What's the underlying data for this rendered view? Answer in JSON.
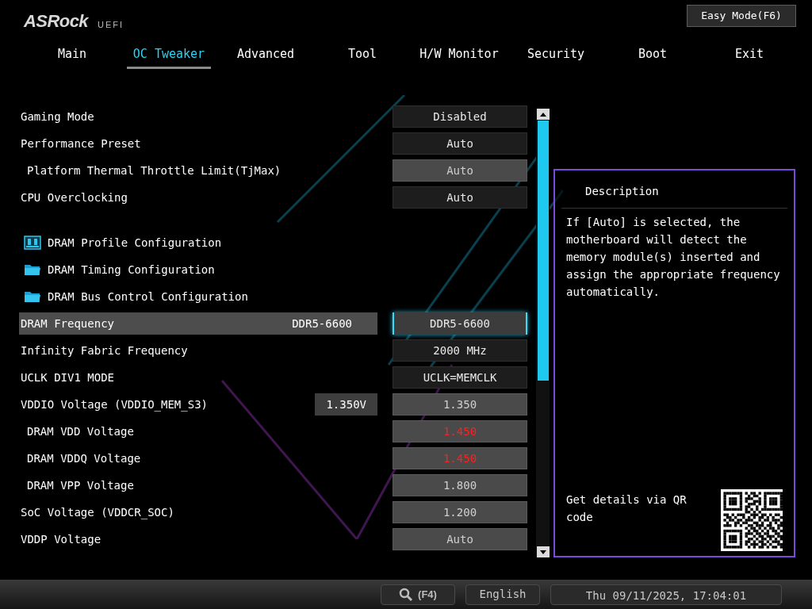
{
  "header": {
    "logo": "ASRock",
    "logo_suffix": "UEFI",
    "mode_button": "Easy Mode(F6)"
  },
  "tabs": [
    {
      "label": "Main",
      "selected": false
    },
    {
      "label": "OC Tweaker",
      "selected": true
    },
    {
      "label": "Advanced",
      "selected": false
    },
    {
      "label": "Tool",
      "selected": false
    },
    {
      "label": "H/W Monitor",
      "selected": false
    },
    {
      "label": "Security",
      "selected": false
    },
    {
      "label": "Boot",
      "selected": false
    },
    {
      "label": "Exit",
      "selected": false
    }
  ],
  "settings": [
    {
      "kind": "option",
      "label": "Gaming Mode",
      "value": "Disabled",
      "indented": false,
      "selected": false,
      "disabled": false,
      "warning": false
    },
    {
      "kind": "option",
      "label": "Performance Preset",
      "value": "Auto",
      "indented": false,
      "selected": false,
      "disabled": false,
      "warning": false
    },
    {
      "kind": "option",
      "label": "Platform Thermal Throttle Limit(TjMax)",
      "value": "Auto",
      "indented": true,
      "selected": false,
      "disabled": true,
      "warning": false
    },
    {
      "kind": "option",
      "label": "CPU Overclocking",
      "value": "Auto",
      "indented": false,
      "selected": false,
      "disabled": false,
      "warning": false
    },
    {
      "kind": "memory-menu",
      "label": "DRAM Profile Configuration"
    },
    {
      "kind": "folder-menu",
      "label": "DRAM Timing Configuration"
    },
    {
      "kind": "folder-menu",
      "label": "DRAM Bus Control Configuration"
    },
    {
      "kind": "option",
      "label": "DRAM Frequency",
      "current": "DDR5-6600",
      "value": "DDR5-6600",
      "indented": false,
      "selected": true,
      "disabled": false,
      "warning": false
    },
    {
      "kind": "option",
      "label": "Infinity Fabric Frequency",
      "value": "2000 MHz",
      "indented": false,
      "selected": false,
      "disabled": false,
      "warning": false
    },
    {
      "kind": "option",
      "label": "UCLK DIV1 MODE",
      "value": "UCLK=MEMCLK",
      "indented": false,
      "selected": false,
      "disabled": false,
      "warning": false
    },
    {
      "kind": "option",
      "label": "VDDIO Voltage (VDDIO_MEM_S3)",
      "reading": "1.350V",
      "value": "1.350",
      "indented": false,
      "selected": false,
      "disabled": true,
      "warning": false
    },
    {
      "kind": "option",
      "label": "DRAM VDD Voltage",
      "value": "1.450",
      "indented": true,
      "selected": false,
      "disabled": true,
      "warning": true
    },
    {
      "kind": "option",
      "label": "DRAM VDDQ Voltage",
      "value": "1.450",
      "indented": true,
      "selected": false,
      "disabled": true,
      "warning": true
    },
    {
      "kind": "option",
      "label": "DRAM VPP Voltage",
      "value": "1.800",
      "indented": true,
      "selected": false,
      "disabled": true,
      "warning": false
    },
    {
      "kind": "option",
      "label": "SoC Voltage (VDDCR_SOC)",
      "value": "1.200",
      "indented": false,
      "selected": false,
      "disabled": true,
      "warning": false
    },
    {
      "kind": "option",
      "label": "VDDP Voltage",
      "value": "Auto",
      "indented": false,
      "selected": false,
      "disabled": true,
      "warning": false
    }
  ],
  "description": {
    "title": "Description",
    "text": "If [Auto] is selected, the motherboard will detect the memory module(s) inserted and assign the appropriate frequency automatically.",
    "qr_caption": "Get details via QR code"
  },
  "status_bar": {
    "search_key": "(F4)",
    "language": "English",
    "datetime": "Thu 09/11/2025, 17:04:01"
  }
}
